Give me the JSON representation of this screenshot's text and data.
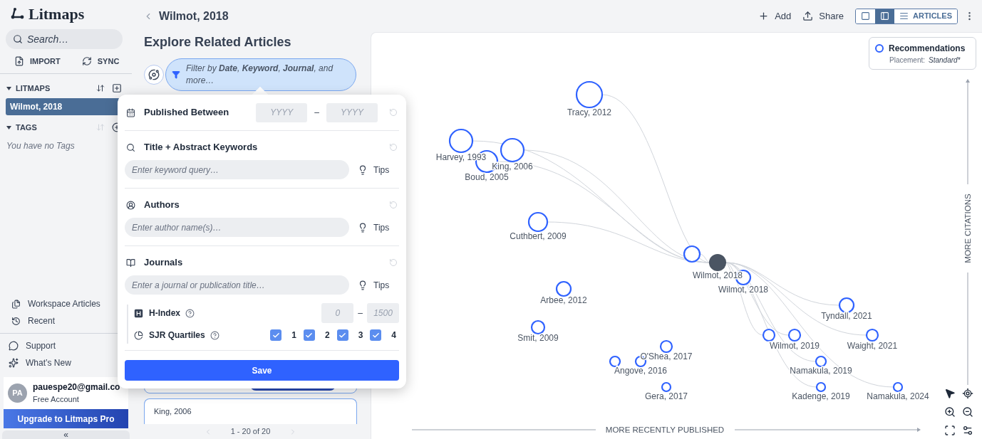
{
  "sidebar": {
    "logo": "Litmaps",
    "search": {
      "placeholder": "Search…"
    },
    "actions": [
      {
        "kind": "import",
        "label": "IMPORT"
      },
      {
        "kind": "sync",
        "label": "SYNC"
      }
    ],
    "litmaps": {
      "title": "LITMAPS",
      "items": [
        {
          "label": "Wilmot, 2018",
          "selected": true
        }
      ]
    },
    "tags": {
      "title": "TAGS",
      "empty": "You have no Tags"
    },
    "links": [
      {
        "kind": "articles",
        "label": "Workspace Articles"
      },
      {
        "kind": "recent",
        "label": "Recent"
      }
    ],
    "help_links": [
      {
        "kind": "support",
        "label": "Support"
      },
      {
        "kind": "new",
        "label": "What’s New"
      }
    ],
    "account": {
      "avatar": "PA",
      "email": "pauespe20@gmail.co",
      "plan": "Free Account"
    },
    "upgrade": "Upgrade to Litmaps Pro",
    "collapse": "«"
  },
  "header": {
    "title": "Wilmot, 2018",
    "actions": [
      {
        "kind": "add",
        "label": "Add"
      },
      {
        "kind": "share",
        "label": "Share"
      }
    ],
    "views": [
      {
        "kind": "map",
        "selected": false
      },
      {
        "kind": "split",
        "selected": true
      },
      {
        "kind": "articles",
        "label": "ARTICLES",
        "selected": false
      }
    ]
  },
  "panel": {
    "title": "Explore Related Articles",
    "filter": "Filter by **Date**, **Keyword**, **Journal**, and more…",
    "articles": [
      "King, 2006"
    ],
    "pagination": "1 - 20 of 20"
  },
  "filter_popover": {
    "sections": [
      {
        "kind": "date",
        "title": "Published Between",
        "from_placeholder": "YYYY",
        "to_placeholder": "YYYY",
        "separator": "–"
      },
      {
        "kind": "keywords",
        "title": "Title + Abstract Keywords",
        "placeholder": "Enter keyword query…",
        "tips": "Tips"
      },
      {
        "kind": "authors",
        "title": "Authors",
        "placeholder": "Enter author name(s)…",
        "tips": "Tips"
      },
      {
        "kind": "journals",
        "title": "Journals",
        "placeholder": "Enter a journal or publication title…",
        "tips": "Tips"
      }
    ],
    "h_index": {
      "label": "H-Index",
      "min_placeholder": "0",
      "max_placeholder": "1500",
      "separator": "–"
    },
    "quartiles": {
      "label": "SJR Quartiles",
      "items": [
        {
          "label": "1",
          "checked": true
        },
        {
          "label": "2",
          "checked": true
        },
        {
          "label": "3",
          "checked": true
        },
        {
          "label": "4",
          "checked": true
        }
      ]
    },
    "save": "Save"
  },
  "map": {
    "legend": {
      "title": "Recommendations",
      "placement_label": "Placement:",
      "placement_value": "Standard*"
    },
    "y_axis": "MORE CITATIONS",
    "x_axis": "MORE RECENTLY PUBLISHED",
    "nodes": [
      {
        "kind": "recommendation",
        "label": "Tracy, 2012"
      },
      {
        "kind": "recommendation",
        "label": "Harvey, 1993"
      },
      {
        "kind": "recommendation",
        "label": "Boud, 2005"
      },
      {
        "kind": "recommendation",
        "label": "King, 2006"
      },
      {
        "kind": "recommendation",
        "label": "Cuthbert, 2009"
      },
      {
        "kind": "recommendation"
      },
      {
        "kind": "seed",
        "label": "Wilmot, 2018"
      },
      {
        "kind": "recommendation",
        "label": "Wilmot, 2018"
      },
      {
        "kind": "recommendation",
        "label": "Arbee, 2012"
      },
      {
        "kind": "recommendation",
        "label": "Smit, 2009"
      },
      {
        "kind": "recommendation",
        "label": "O'Shea, 2017"
      },
      {
        "kind": "recommendation"
      },
      {
        "kind": "recommendation",
        "label": "Angove, 2016"
      },
      {
        "kind": "recommendation",
        "label": "Gera, 2017"
      },
      {
        "kind": "recommendation",
        "label": "Tyndall, 2021"
      },
      {
        "kind": "recommendation"
      },
      {
        "kind": "recommendation",
        "label": "Wilmot, 2019"
      },
      {
        "kind": "recommendation",
        "label": "Waight, 2021"
      },
      {
        "kind": "recommendation",
        "label": "Namakula, 2019"
      },
      {
        "kind": "recommendation",
        "label": "Kadenge, 2019"
      },
      {
        "kind": "recommendation",
        "label": "Namakula, 2024"
      }
    ]
  }
}
